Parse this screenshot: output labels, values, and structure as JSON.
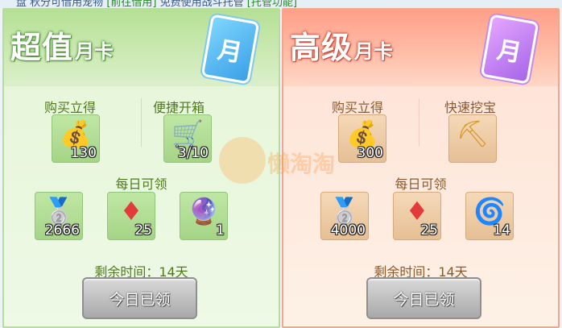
{
  "topbar": {
    "prefix": "盘",
    "text_a": "秋分可借用宠物",
    "link_a": "[前往借用]",
    "text_b": "免费使用战斗托管",
    "link_b": "[托管功能]"
  },
  "basic": {
    "title_big": "超值",
    "title_small": "月卡",
    "card_glyph": "月",
    "instant_label": "购买立得",
    "quick_label": "便捷开箱",
    "instant_item": {
      "icon": "gold-ingot-icon",
      "glyph": "💰",
      "qty": "130"
    },
    "quick_item": {
      "icon": "treasure-cart-icon",
      "glyph": "🛒",
      "qty": "3/10"
    },
    "daily_label": "每日可领",
    "daily_items": [
      {
        "icon": "silver-ingot-icon",
        "glyph": "🥈",
        "qty": "2666"
      },
      {
        "icon": "red-crystal-icon",
        "glyph": "♦",
        "qty": "25"
      },
      {
        "icon": "energy-orb-icon",
        "glyph": "🔮",
        "qty": "1"
      }
    ],
    "time_text": "剩余时间：14天",
    "button_label": "今日已领"
  },
  "premium": {
    "title_big": "高级",
    "title_small": "月卡",
    "card_glyph": "月",
    "instant_label": "购买立得",
    "quick_label": "快速挖宝",
    "instant_item": {
      "icon": "gold-ingot-icon",
      "glyph": "💰",
      "qty": "300"
    },
    "quick_item": {
      "icon": "shovel-icon",
      "glyph": "⛏",
      "qty": ""
    },
    "daily_label": "每日可领",
    "daily_items": [
      {
        "icon": "silver-ingot-icon",
        "glyph": "🥈",
        "qty": "4000"
      },
      {
        "icon": "red-crystal-icon",
        "glyph": "♦",
        "qty": "25"
      },
      {
        "icon": "swirl-orb-icon",
        "glyph": "🌀",
        "qty": "14"
      }
    ],
    "time_text": "剩余时间：14天",
    "button_label": "今日已领"
  },
  "watermark": {
    "text": "懒淘淘"
  }
}
